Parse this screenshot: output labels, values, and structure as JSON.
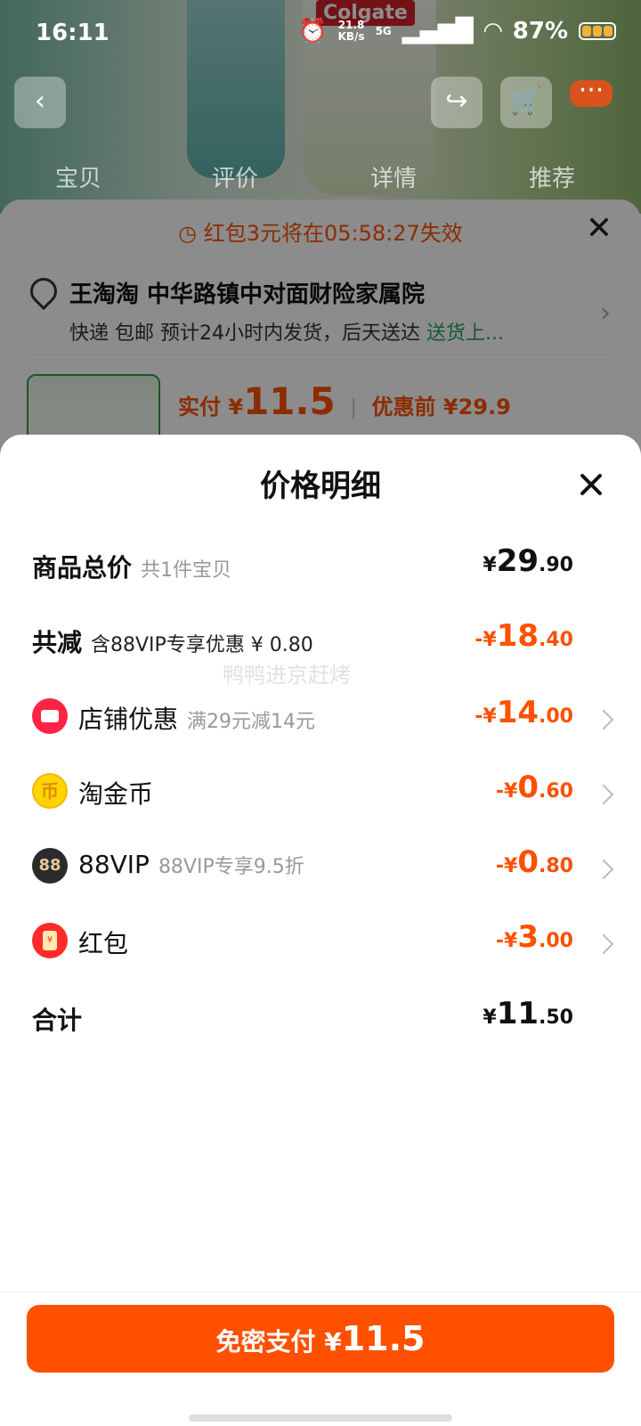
{
  "status_bar": {
    "time": "16:11",
    "speed_value": "21.8",
    "speed_unit": "KB/s",
    "network": "5G",
    "battery": "87%"
  },
  "background": {
    "brand": "Colgate",
    "tabs": [
      "宝贝",
      "评价",
      "详情",
      "推荐"
    ],
    "nav_icons": [
      "back-icon",
      "share-icon",
      "cart-icon",
      "more-icon"
    ]
  },
  "order": {
    "countdown": "红包3元将在05:58:27失效",
    "address_name": "王淘淘 中华路镇中对面财险家属院",
    "delivery": "快递 包邮 预计24小时内发货，后天送达",
    "delivery_link": "送货上...",
    "paid_label": "实付",
    "paid_currency": "¥",
    "paid_amount": "11.5",
    "before_discount": "优惠前 ¥29.9"
  },
  "price_detail": {
    "title": "价格明细",
    "rows": [
      {
        "label": "商品总价",
        "note": "共1件宝贝",
        "sign": "",
        "int": "29",
        "dec": ".90",
        "red": false
      },
      {
        "label": "共减",
        "note": "含88VIP专享优惠 ¥ 0.80",
        "sign": "-",
        "int": "18",
        "dec": ".40",
        "red": true
      },
      {
        "label": "店铺优惠",
        "note": "满29元减14元",
        "sign": "-",
        "int": "14",
        "dec": ".00",
        "icon": "shop-coupon-icon"
      },
      {
        "label": "淘金币",
        "note": "",
        "sign": "-",
        "int": "0",
        "dec": ".60",
        "icon": "tao-coin-icon"
      },
      {
        "label": "88VIP",
        "note": "88VIP专享9.5折",
        "sign": "-",
        "int": "0",
        "dec": ".80",
        "icon": "vip-88-icon"
      },
      {
        "label": "红包",
        "note": "",
        "sign": "-",
        "int": "3",
        "dec": ".00",
        "icon": "red-packet-icon"
      },
      {
        "label": "合计",
        "note": "",
        "sign": "",
        "int": "11",
        "dec": ".50",
        "red": false
      }
    ],
    "currency": "¥",
    "watermark": "鸭鸭进京赶烤",
    "pay_label": "免密支付",
    "pay_amount": "11.5",
    "colors": {
      "accent": "#ff5000",
      "text": "#111111",
      "muted": "#999999"
    }
  }
}
